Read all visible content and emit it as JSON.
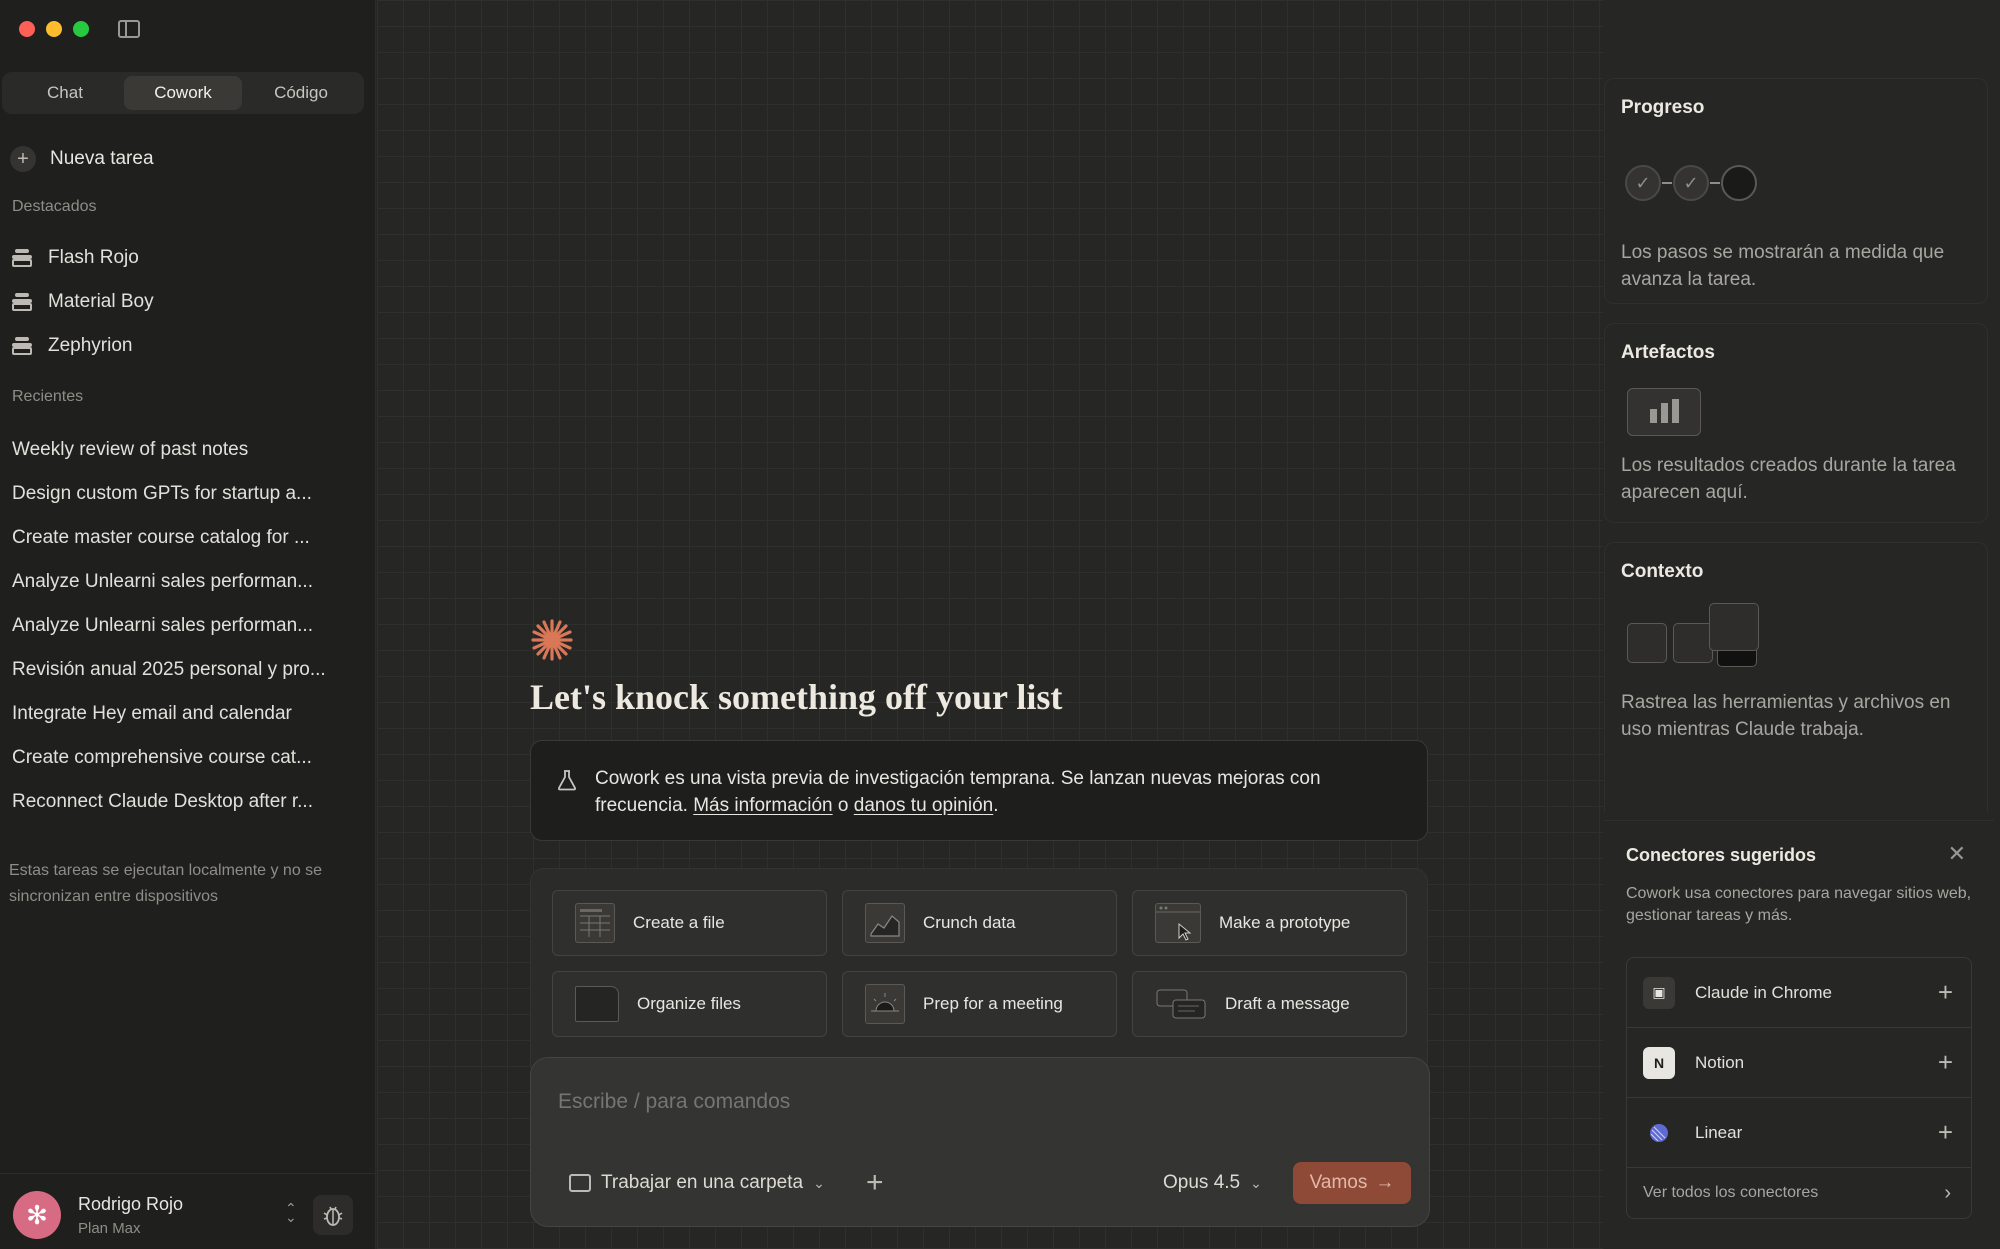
{
  "sidebar": {
    "tabs": [
      {
        "label": "Chat",
        "active": false
      },
      {
        "label": "Cowork",
        "active": true
      },
      {
        "label": "Código",
        "active": false
      }
    ],
    "new_task": "Nueva tarea",
    "favorites_label": "Destacados",
    "favorites": [
      "Flash Rojo",
      "Material Boy",
      "Zephyrion"
    ],
    "recents_label": "Recientes",
    "recents": [
      "Weekly review of past notes",
      "Design custom GPTs for startup a...",
      "Create master course catalog for ...",
      "Analyze Unlearni sales performan...",
      "Analyze Unlearni sales performan...",
      "Revisión anual 2025 personal y pro...",
      "Integrate Hey email and calendar",
      "Create comprehensive course cat...",
      "Reconnect Claude Desktop after r..."
    ],
    "local_note": "Estas tareas se ejecutan localmente y no se sincronizan entre dispositivos",
    "user": {
      "name": "Rodrigo Rojo",
      "plan": "Plan Max"
    }
  },
  "main": {
    "headline": "Let's knock something off your list",
    "notice": {
      "text": "Cowork es una vista previa de investigación temprana. Se lanzan nuevas mejoras con frecuencia.",
      "link1": "Más información",
      "conj": "o",
      "link2": "danos tu opinión",
      "end": "."
    },
    "quick_actions": [
      {
        "label": "Create a file",
        "icon": "spreadsheet-icon"
      },
      {
        "label": "Crunch data",
        "icon": "chart-icon"
      },
      {
        "label": "Make a prototype",
        "icon": "window-icon"
      },
      {
        "label": "Organize files",
        "icon": "folder-icon"
      },
      {
        "label": "Prep for a meeting",
        "icon": "sunrise-icon"
      },
      {
        "label": "Draft a message",
        "icon": "chat-bubbles-icon"
      }
    ],
    "composer": {
      "placeholder": "Escribe / para comandos",
      "folder": "Trabajar en una carpeta",
      "model": "Opus 4.5",
      "submit": "Vamos"
    }
  },
  "right_panel": {
    "progress": {
      "title": "Progreso",
      "desc": "Los pasos se mostrarán a medida que avanza la tarea."
    },
    "artifacts": {
      "title": "Artefactos",
      "desc": "Los resultados creados durante la tarea aparecen aquí."
    },
    "context": {
      "title": "Contexto",
      "desc": "Rastrea las herramientas y archivos en uso mientras Claude trabaja."
    },
    "connectors": {
      "title": "Conectores sugeridos",
      "desc": "Cowork usa conectores para navegar sitios web, gestionar tareas y más.",
      "items": [
        "Claude in Chrome",
        "Notion",
        "Linear"
      ],
      "see_all": "Ver todos los conectores"
    }
  },
  "colors": {
    "accent": "#d97757",
    "submit_bg": "#8e4a36",
    "avatar": "#d86b84"
  }
}
